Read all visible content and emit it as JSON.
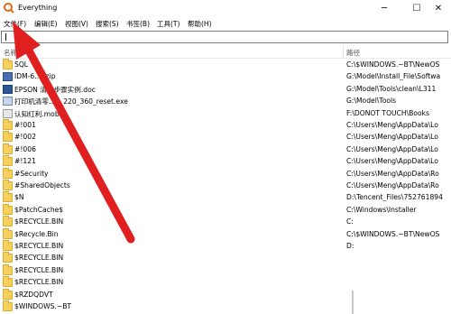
{
  "window": {
    "title": "Everything",
    "minimize": "─",
    "maximize": "☐",
    "close": "✕"
  },
  "menu": [
    {
      "label": "文件(F)"
    },
    {
      "label": "编辑(E)"
    },
    {
      "label": "视图(V)"
    },
    {
      "label": "搜索(S)"
    },
    {
      "label": "书签(B)"
    },
    {
      "label": "工具(T)"
    },
    {
      "label": "帮助(H)"
    }
  ],
  "search": {
    "value": "",
    "placeholder": ""
  },
  "columns": {
    "name": "名称",
    "path": "路径"
  },
  "files": [
    {
      "icon": "folder-icon",
      "name": "SQL",
      "path": "C:\\$WINDOWS.~BT\\NewOS"
    },
    {
      "icon": "zip-icon",
      "name": "IDM-6.….zip",
      "path": "G:\\Model\\Install_File\\Softwa"
    },
    {
      "icon": "doc-icon",
      "name": "EPSON 清洁步骤实例.doc",
      "path": "G:\\Model\\Tools\\clean\\L311"
    },
    {
      "icon": "exe-icon",
      "name": "打印机清零…0_220_360_reset.exe",
      "path": "G:\\Model\\Tools"
    },
    {
      "icon": "mobi-icon",
      "name": "认知红利.mobi",
      "path": "F:\\DONOT TOUCH\\Books"
    },
    {
      "icon": "folder-icon",
      "name": "#!001",
      "path": "C:\\Users\\Meng\\AppData\\Lo"
    },
    {
      "icon": "folder-icon",
      "name": "#!002",
      "path": "C:\\Users\\Meng\\AppData\\Lo"
    },
    {
      "icon": "folder-icon",
      "name": "#!006",
      "path": "C:\\Users\\Meng\\AppData\\Lo"
    },
    {
      "icon": "folder-icon",
      "name": "#!121",
      "path": "C:\\Users\\Meng\\AppData\\Lo"
    },
    {
      "icon": "folder-icon",
      "name": "#Security",
      "path": "C:\\Users\\Meng\\AppData\\Ro"
    },
    {
      "icon": "folder-icon",
      "name": "#SharedObjects",
      "path": "C:\\Users\\Meng\\AppData\\Ro"
    },
    {
      "icon": "folder-icon",
      "name": "$N",
      "path": "D:\\Tencent_Files\\752761894"
    },
    {
      "icon": "folder-icon",
      "name": "$PatchCache$",
      "path": "C:\\Windows\\Installer"
    },
    {
      "icon": "folder-icon",
      "name": "$RECYCLE.BIN",
      "path": "C:"
    },
    {
      "icon": "folder-icon",
      "name": "$Recycle.Bin",
      "path": "C:\\$WINDOWS.~BT\\NewOS"
    },
    {
      "icon": "folder-icon",
      "name": "$RECYCLE.BIN",
      "path": "D:"
    },
    {
      "icon": "folder-icon",
      "name": "$RECYCLE.BIN",
      "path": ""
    },
    {
      "icon": "folder-icon",
      "name": "$RECYCLE.BIN",
      "path": ""
    },
    {
      "icon": "folder-icon",
      "name": "$RECYCLE.BIN",
      "path": ""
    },
    {
      "icon": "folder-icon",
      "name": "$RZDQDVT",
      "path": ""
    },
    {
      "icon": "folder-icon",
      "name": "$WINDOWS.~BT",
      "path": ""
    }
  ],
  "colors": {
    "arrow": "#e02020",
    "folder": "#f6cf5c"
  }
}
